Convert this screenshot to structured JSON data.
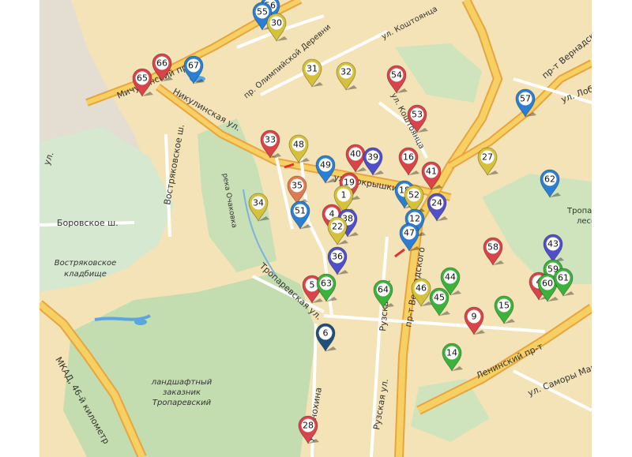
{
  "map": {
    "streets": [
      {
        "text": "Мичуринский пр-т"
      },
      {
        "text": "пр. Олимпийской Деревни"
      },
      {
        "text": "ул. Коштоянца"
      },
      {
        "text": "ул. Коштоянца"
      },
      {
        "text": "пр-т Вернадского"
      },
      {
        "text": "ул. Лобачевского"
      },
      {
        "text": "Никулинская ул."
      },
      {
        "text": "Востряковское ш."
      },
      {
        "text": "Боровское ш."
      },
      {
        "text": "река Очаковка"
      },
      {
        "text": "ул. Покрышкина"
      },
      {
        "text": "Тропаревская ул."
      },
      {
        "text": "Рузская ул."
      },
      {
        "text": "пр-т Вернадского"
      },
      {
        "text": "Ленинский пр-т"
      },
      {
        "text": "ул. Саморы Машела"
      },
      {
        "text": "ул. Анохина"
      },
      {
        "text": "Рузская ул."
      },
      {
        "text": "МКАД, 46-й километр"
      },
      {
        "text": "ул."
      }
    ],
    "areas": [
      {
        "lines": [
          "Востряковское",
          "кладбище"
        ]
      },
      {
        "lines": [
          "ландшафтный",
          "заказник",
          "Тропаревский"
        ]
      },
      {
        "lines": [
          "Тропарев",
          "лесо"
        ]
      }
    ],
    "markers": [
      {
        "label": "56",
        "color": "#2a7fd4"
      },
      {
        "label": "55",
        "color": "#2a7fd4"
      },
      {
        "label": "30",
        "color": "#d6c23a"
      },
      {
        "label": "66",
        "color": "#d9434a"
      },
      {
        "label": "65",
        "color": "#d9434a"
      },
      {
        "label": "67",
        "color": "#2a7fd4"
      },
      {
        "label": "31",
        "color": "#d6c23a"
      },
      {
        "label": "32",
        "color": "#d6c23a"
      },
      {
        "label": "54",
        "color": "#d9434a"
      },
      {
        "label": "53",
        "color": "#d9434a"
      },
      {
        "label": "57",
        "color": "#2a7fd4"
      },
      {
        "label": "33",
        "color": "#d9434a"
      },
      {
        "label": "48",
        "color": "#d6c23a"
      },
      {
        "label": "49",
        "color": "#2a7fd4"
      },
      {
        "label": "40",
        "color": "#d9434a"
      },
      {
        "label": "39",
        "color": "#4e4fc9"
      },
      {
        "label": "16",
        "color": "#d9434a"
      },
      {
        "label": "27",
        "color": "#d6c23a"
      },
      {
        "label": "41",
        "color": "#d9434a"
      },
      {
        "label": "62",
        "color": "#2a7fd4"
      },
      {
        "label": "19",
        "color": "#d9434a"
      },
      {
        "label": "35",
        "color": "#e07a52"
      },
      {
        "label": "1",
        "color": "#d6c23a"
      },
      {
        "label": "18",
        "color": "#2a7fd4"
      },
      {
        "label": "52",
        "color": "#d6c23a"
      },
      {
        "label": "24",
        "color": "#4e4fc9"
      },
      {
        "label": "34",
        "color": "#d6c23a"
      },
      {
        "label": "51",
        "color": "#2a7fd4"
      },
      {
        "label": "4",
        "color": "#d9434a"
      },
      {
        "label": "38",
        "color": "#4e4fc9"
      },
      {
        "label": "22",
        "color": "#d6c23a"
      },
      {
        "label": "12",
        "color": "#2a7fd4"
      },
      {
        "label": "47",
        "color": "#2a7fd4"
      },
      {
        "label": "58",
        "color": "#d9434a"
      },
      {
        "label": "43",
        "color": "#4e4fc9"
      },
      {
        "label": "36",
        "color": "#4e4fc9"
      },
      {
        "label": "59",
        "color": "#3bb23a"
      },
      {
        "label": "4",
        "color": "#d9434a"
      },
      {
        "label": "60",
        "color": "#3bb23a"
      },
      {
        "label": "61",
        "color": "#3bb23a"
      },
      {
        "label": "44",
        "color": "#3bb23a"
      },
      {
        "label": "5",
        "color": "#d9434a"
      },
      {
        "label": "63",
        "color": "#3bb23a"
      },
      {
        "label": "64",
        "color": "#3bb23a"
      },
      {
        "label": "46",
        "color": "#d6c23a"
      },
      {
        "label": "45",
        "color": "#3bb23a"
      },
      {
        "label": "15",
        "color": "#3bb23a"
      },
      {
        "label": "9",
        "color": "#d9434a"
      },
      {
        "label": "6",
        "color": "#1f4f7a"
      },
      {
        "label": "14",
        "color": "#3bb23a"
      },
      {
        "label": "28",
        "color": "#d9434a"
      }
    ]
  }
}
